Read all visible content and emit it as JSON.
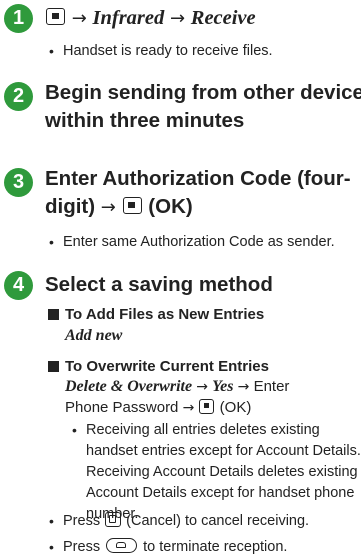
{
  "step1": {
    "number": "1",
    "arrow": "→",
    "menu_infrared": "Infrared",
    "menu_receive": "Receive",
    "note": "Handset is ready to receive files."
  },
  "step2": {
    "number": "2",
    "line1": "Begin sending from other device",
    "line2": "within three minutes"
  },
  "step3": {
    "number": "3",
    "line1": "Enter Authorization Code (four-",
    "line2_prefix": "digit)",
    "arrow": "→",
    "ok": "(OK)",
    "note": "Enter same Authorization Code as sender."
  },
  "step4": {
    "number": "4",
    "heading": "Select a saving method",
    "add_title": "To Add Files as New Entries",
    "add_option": "Add new",
    "overwrite_title": "To Overwrite Current Entries",
    "overwrite_option": "Delete & Overwrite",
    "arrow": "→",
    "yes": "Yes",
    "enter": "Enter",
    "phone_password": "Phone Password",
    "ok": "(OK)",
    "note_lines": [
      "Receiving all entries deletes existing",
      "handset entries except for Account Details.",
      "Receiving Account Details deletes existing",
      "Account Details except for handset phone",
      "number."
    ],
    "cancel_prefix": "Press",
    "cancel_suffix": "(Cancel) to cancel receiving.",
    "terminate_prefix": "Press",
    "terminate_suffix": "to terminate reception."
  }
}
